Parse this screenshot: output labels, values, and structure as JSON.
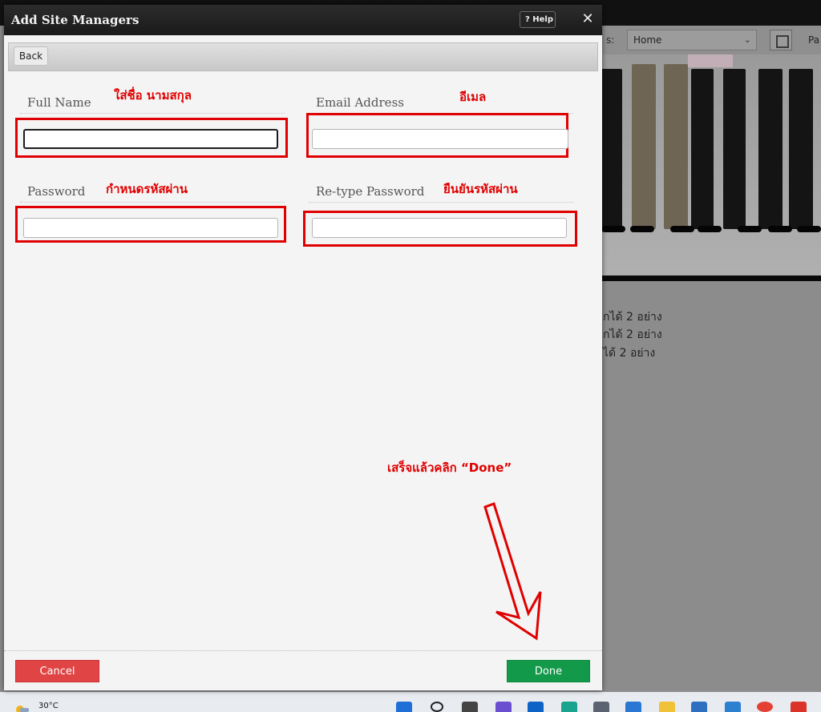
{
  "background": {
    "toolbar": {
      "pages_label_fragment": "s:",
      "page_select_value": "Home",
      "right_fragment": "Pa"
    },
    "text_lines": [
      "กได้ 2 อย่าง",
      "กได้ 2 อย่าง",
      "ได้ 2 อย่าง"
    ],
    "taskbar": {
      "temperature": "30°C"
    }
  },
  "modal": {
    "title": "Add Site Managers",
    "help_label": "? Help",
    "close_glyph": "✕",
    "back_label": "Back",
    "fields": {
      "full_name": {
        "label": "Full Name",
        "value": ""
      },
      "email": {
        "label": "Email Address",
        "value": ""
      },
      "password": {
        "label": "Password",
        "value": ""
      },
      "retype_password": {
        "label": "Re-type Password",
        "value": ""
      }
    },
    "cancel_label": "Cancel",
    "done_label": "Done"
  },
  "annotations": {
    "full_name": "ใส่ชื่อ นามสกุล",
    "email": "อีเมล",
    "password": "กำหนดรหัสผ่าน",
    "retype_password": "ยืนยันรหัสผ่าน",
    "done_hint": "เสร็จแล้วคลิก “Done”"
  },
  "colors": {
    "annotation_red": "#e00000",
    "done_green": "#12994a",
    "cancel_red": "#e04444",
    "header_dark": "#1f1f1f"
  }
}
